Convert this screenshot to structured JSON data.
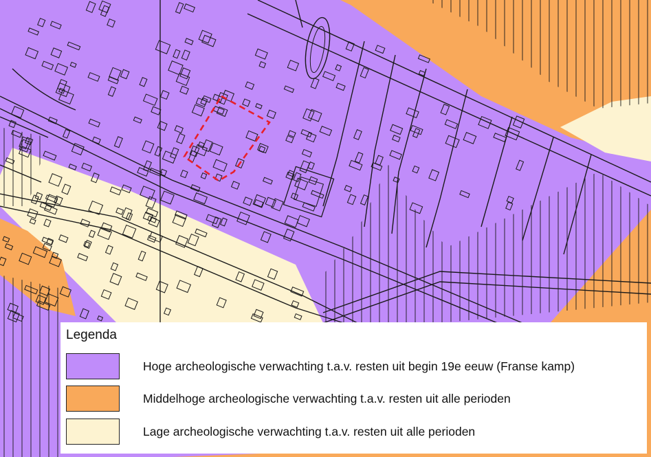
{
  "legend": {
    "title": "Legenda",
    "items": [
      {
        "label": "Hoge archeologische verwachting t.a.v. resten uit begin 19e eeuw (Franse kamp)",
        "color": "#c08cfa"
      },
      {
        "label": "Middelhoge archeologische verwachting t.a.v. resten uit alle perioden",
        "color": "#f9a95a"
      },
      {
        "label": "Lage archeologische verwachting t.a.v. resten uit alle perioden",
        "color": "#fdf3d1"
      }
    ]
  },
  "map": {
    "colors": {
      "high": "#c08cfa",
      "medium": "#f9a95a",
      "low": "#fdf3d1",
      "outline": "#1a1a1a",
      "highlight": "#e8202a"
    }
  }
}
